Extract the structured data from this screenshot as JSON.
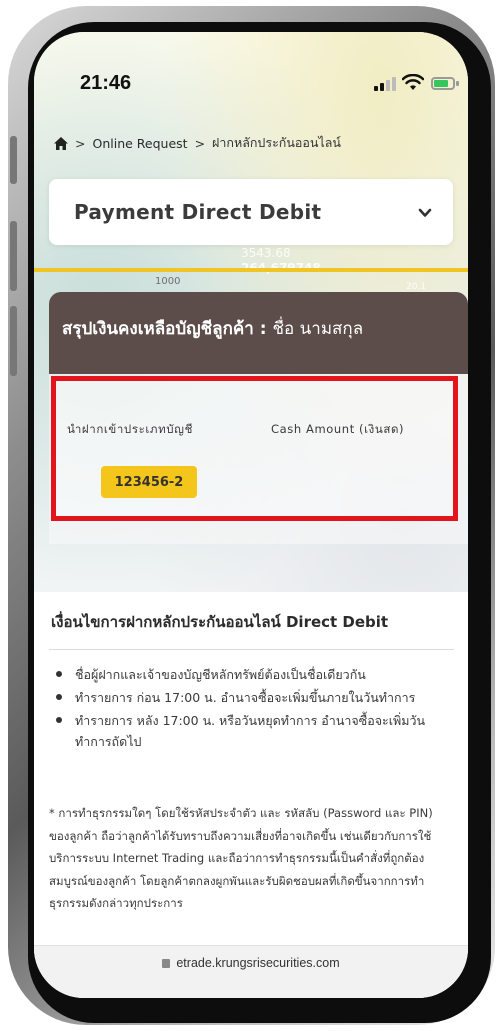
{
  "status_bar": {
    "time": "21:46"
  },
  "breadcrumb": {
    "items": [
      "Online Request",
      "ฝากหลักประกันออนไลน์"
    ],
    "separator": ">"
  },
  "dropdown": {
    "selected": "Payment Direct Debit"
  },
  "background_numbers": [
    "3543.68",
    "264,679748",
    "20.1",
    "1000"
  ],
  "summary": {
    "title": "สรุปเงินคงเหลือบัญชีลูกค้า :",
    "customer_name": "ชื่อ นามสกุล",
    "columns": [
      "นำฝากเข้าประเภทบัญชี",
      "Cash Amount (เงินสด)"
    ],
    "account_number": "123456-2"
  },
  "terms": {
    "title": "เงื่อนไขการฝากหลักประกันออนไลน์ Direct Debit",
    "items": [
      "ชื่อผู้ฝากและเจ้าของบัญชีหลักทรัพย์ต้องเป็นชื่อเดียวกัน",
      "ทำรายการ ก่อน 17:00 น. อำนาจซื้อจะเพิ่มขึ้นภายในวันทำการ",
      "ทำรายการ หลัง 17:00 น. หรือวันหยุดทำการ อำนาจซื้อจะเพิ่มวันทำการถัดไป"
    ],
    "note": "* การทำธุรกรรมใดๆ โดยใช้รหัสประจำตัว และ รหัสลับ (Password และ PIN) ของลูกค้า ถือว่าลูกค้าได้รับทราบถึงความเสี่ยงที่อาจเกิดขึ้น เช่นเดียวกับการใช้บริการระบบ Internet Trading และถือว่าการทำธุรกรรมนี้เป็นคำสั่งที่ถูกต้องสมบูรณ์ของลูกค้า โดยลูกค้าตกลงผูกพันและรับผิดชอบผลที่เกิดขึ้นจากการทำธุรกรรมดังกล่าวทุกประการ"
  },
  "browser": {
    "url": "etrade.krungsrisecurities.com"
  },
  "colors": {
    "summary_header": "#5c4d4a",
    "highlight_border": "#e4141c",
    "account_badge": "#f4c51a",
    "gold_line": "#efc425"
  }
}
